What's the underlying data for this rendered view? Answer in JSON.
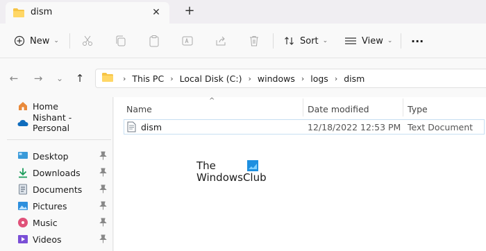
{
  "tab": {
    "title": "dism",
    "close": "✕",
    "new_tab": "+"
  },
  "toolbar": {
    "new_label": "New",
    "sort_label": "Sort",
    "view_label": "View",
    "more": "···"
  },
  "nav": {
    "back": "←",
    "forward": "→",
    "recent": "⌄",
    "up": "↑"
  },
  "breadcrumb": [
    "This PC",
    "Local Disk (C:)",
    "windows",
    "logs",
    "dism"
  ],
  "breadcrumb_sep": "›",
  "sidebar": {
    "top_items": [
      {
        "label": "Home",
        "icon": "home-icon"
      },
      {
        "label": "Nishant - Personal",
        "icon": "cloud-icon"
      }
    ],
    "pinned_items": [
      {
        "label": "Desktop",
        "icon": "desktop-icon"
      },
      {
        "label": "Downloads",
        "icon": "download-icon"
      },
      {
        "label": "Documents",
        "icon": "documents-icon"
      },
      {
        "label": "Pictures",
        "icon": "pictures-icon"
      },
      {
        "label": "Music",
        "icon": "music-icon"
      },
      {
        "label": "Videos",
        "icon": "videos-icon"
      }
    ]
  },
  "columns": {
    "name": "Name",
    "date": "Date modified",
    "type": "Type"
  },
  "files": [
    {
      "name": "dism",
      "date": "12/18/2022 12:53 PM",
      "type": "Text Document"
    }
  ],
  "watermark": {
    "line1": "The",
    "line2": "WindowsClub"
  },
  "colors": {
    "accent": "#0067c0",
    "folder": "#f6c445",
    "selection_border": "#c7dff2"
  }
}
